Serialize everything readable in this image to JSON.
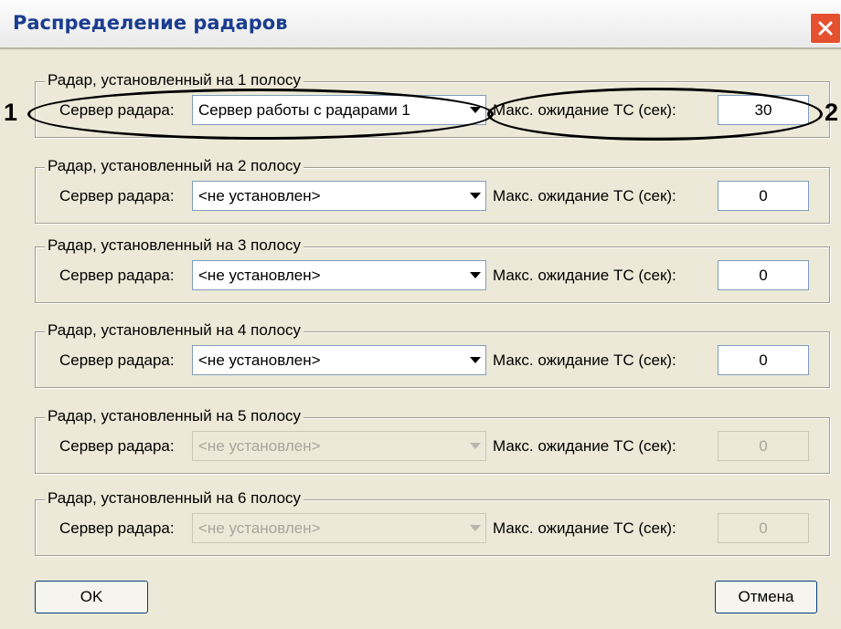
{
  "window": {
    "title": "Распределение радаров",
    "close_icon": "close-icon"
  },
  "groups": [
    {
      "title": "Радар, установленный на 1 полосу",
      "server_label": "Сервер радара:",
      "server_value": "Сервер работы с радарами 1",
      "wait_label": "Макс. ожидание ТС (сек):",
      "wait_value": "30"
    },
    {
      "title": "Радар, установленный на 2 полосу",
      "server_label": "Сервер радара:",
      "server_value": "<не установлен>",
      "wait_label": "Макс. ожидание ТС (сек):",
      "wait_value": "0"
    },
    {
      "title": "Радар, установленный на 3 полосу",
      "server_label": "Сервер радара:",
      "server_value": "<не установлен>",
      "wait_label": "Макс. ожидание ТС (сек):",
      "wait_value": "0"
    },
    {
      "title": "Радар, установленный на 4 полосу",
      "server_label": "Сервер радара:",
      "server_value": "<не установлен>",
      "wait_label": "Макс. ожидание ТС (сек):",
      "wait_value": "0"
    },
    {
      "title": "Радар, установленный на 5 полосу",
      "server_label": "Сервер радара:",
      "server_value": "<не установлен>",
      "wait_label": "Макс. ожидание ТС (сек):",
      "wait_value": "0",
      "disabled": true
    },
    {
      "title": "Радар, установленный на 6 полосу",
      "server_label": "Сервер радара:",
      "server_value": "<не установлен>",
      "wait_label": "Макс. ожидание ТС (сек):",
      "wait_value": "0",
      "disabled": true
    }
  ],
  "buttons": {
    "ok": "OK",
    "cancel": "Отмена"
  },
  "callouts": {
    "one": "1",
    "two": "2"
  },
  "icons": {
    "dropdown": "chevron-down-icon"
  }
}
